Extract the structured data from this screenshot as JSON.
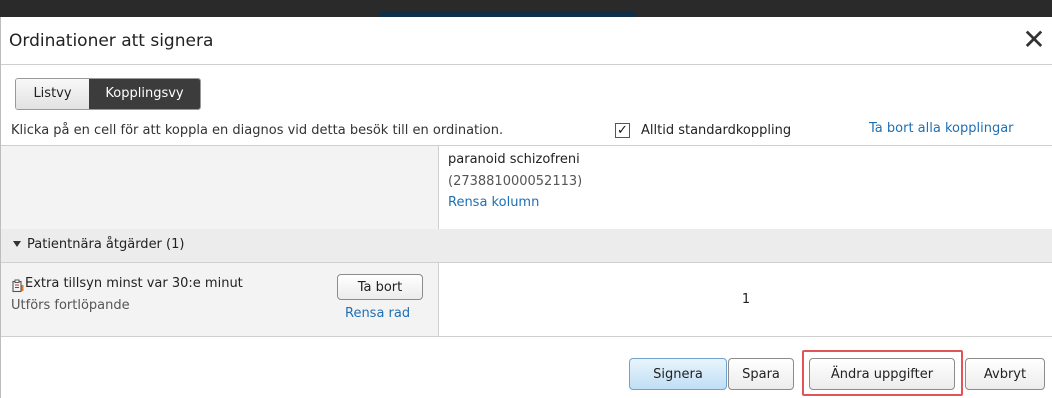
{
  "window": {
    "title": "Ordinationer att signera",
    "close_symbol": "✕"
  },
  "view_toggle": {
    "options": [
      "Listvy",
      "Kopplingsvy"
    ],
    "selected": "Kopplingsvy"
  },
  "info": {
    "instruction": "Klicka på en cell för att koppla en diagnos vid detta besök till en ordination.",
    "checkbox_checked": true,
    "checkbox_mark": "✓",
    "checkbox_label": "Alltid standardkoppling",
    "remove_all_link": "Ta bort alla kopplingar"
  },
  "diagnosis_column": {
    "name": "paranoid schizofreni",
    "code": "(273881000052113)",
    "clear_link": "Rensa kolumn"
  },
  "group": {
    "label": "Patientnära åtgärder (1)",
    "expanded": true
  },
  "order": {
    "icon": "clipboard-icon",
    "name": "Extra tillsyn minst var 30:e minut",
    "subtitle": "Utförs fortlöpande",
    "remove_button": "Ta bort",
    "clear_row_link": "Rensa rad",
    "link_value": "1"
  },
  "footer": {
    "sign_button": "Signera",
    "save_button": "Spara",
    "edit_button": "Ändra uppgifter",
    "cancel_button": "Avbryt"
  },
  "colors": {
    "link": "#1f6fb5",
    "highlight": "#e0555a",
    "primary_button": "#bfdff5",
    "active_tab": "#3c3c3c"
  }
}
